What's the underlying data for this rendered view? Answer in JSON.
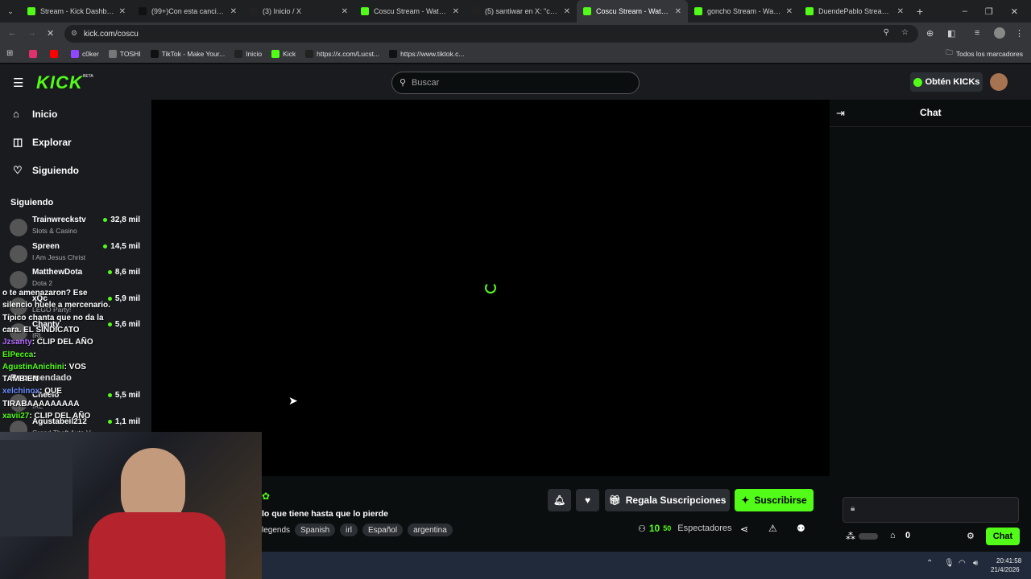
{
  "browser": {
    "tabs": [
      {
        "title": "Stream - Kick Dashboard",
        "icon": "kick-icon",
        "active": false
      },
      {
        "title": "(99+)Con esta canción m",
        "icon": "tiktok-icon",
        "active": false
      },
      {
        "title": "(3) Inicio / X",
        "icon": "x-icon",
        "active": false
      },
      {
        "title": "Coscu Stream - Watch Liv",
        "icon": "kick-icon",
        "active": false
      },
      {
        "title": "(5) santiwar en X: \"coscu c",
        "icon": "x-icon",
        "active": false
      },
      {
        "title": "Coscu Stream - Watch Liv",
        "icon": "kick-icon",
        "active": true
      },
      {
        "title": "goncho Stream - Watch L",
        "icon": "kick-icon",
        "active": false
      },
      {
        "title": "DuendePablo Stream - W",
        "icon": "kick-icon",
        "active": false
      }
    ],
    "url": "kick.com/coscu",
    "bookmarks": [
      {
        "label": "",
        "icon": "instagram-icon"
      },
      {
        "label": "",
        "icon": "youtube-icon"
      },
      {
        "label": "c0ker",
        "icon": "twitch-icon"
      },
      {
        "label": "TOSHI",
        "icon": "bookmark-icon"
      },
      {
        "label": "TikTok - Make Your...",
        "icon": "tiktok-icon"
      },
      {
        "label": "Inicio",
        "icon": "x-icon"
      },
      {
        "label": "Kick",
        "icon": "kick-icon"
      },
      {
        "label": "https://x.com/Lucst...",
        "icon": "x-icon"
      },
      {
        "label": "https://www.tiktok.c...",
        "icon": "tiktok-icon"
      }
    ],
    "all_bookmarks": "Todos los marcadores"
  },
  "header": {
    "logo": "KICK",
    "beta": "BETA",
    "search_placeholder": "Buscar",
    "kicks_button": "Obtén KICKs"
  },
  "sidebar": {
    "nav": [
      {
        "label": "Inicio",
        "icon": "home-icon"
      },
      {
        "label": "Explorar",
        "icon": "compass-icon"
      },
      {
        "label": "Siguiendo",
        "icon": "heart-icon"
      }
    ],
    "following_title": "Siguiendo",
    "following": [
      {
        "name": "Trainwreckstv",
        "category": "Slots & Casino",
        "viewers": "32,8 mil"
      },
      {
        "name": "Spreen",
        "category": "I Am Jesus Christ",
        "viewers": "14,5 mil"
      },
      {
        "name": "MatthewDota",
        "category": "Dota 2",
        "viewers": "8,6 mil"
      },
      {
        "name": "xQc",
        "category": "LEGO Party!",
        "viewers": "5,9 mil"
      },
      {
        "name": "Chanty",
        "category": "IRL",
        "viewers": "5,6 mil"
      }
    ],
    "recommended_title": "Recomendado",
    "recommended": [
      {
        "name": "Cheelo",
        "category": "IRL",
        "viewers": "5,5 mil"
      },
      {
        "name": "Agustabell212",
        "category": "Grand Theft Auto V",
        "viewers": "1,1 mil"
      }
    ]
  },
  "chat_overlay": [
    {
      "user": "",
      "text": "o te amenazaron? Ese"
    },
    {
      "user": "",
      "text": "silencio huele a mercenario."
    },
    {
      "user": "",
      "text": "Típico chanta que no da la"
    },
    {
      "user": "",
      "text": "cara. EL SINDICATO"
    },
    {
      "user": "Jzsanty",
      "text": ": CLIP DEL AÑO",
      "color": "#b36bff"
    },
    {
      "user": "ElPecca",
      "text": ":",
      "color": "#53fc18"
    },
    {
      "user": "AgustinAnichini",
      "text": ": VOS",
      "color": "#53fc18"
    },
    {
      "user": "",
      "text": "TAMBIEN"
    },
    {
      "user": "xelchinox",
      "text": ": QUE",
      "color": "#6b8cff"
    },
    {
      "user": "",
      "text": "TIRABAAAAAAAAA"
    },
    {
      "user": "xavii27",
      "text": ": CLIP DEL AÑO",
      "color": "#53fc18"
    }
  ],
  "stream": {
    "title": "lo que tiene hasta que lo pierde",
    "tags": [
      "legends",
      "Spanish",
      "irl",
      "Español",
      "argentina"
    ],
    "gift_button": "Regala Suscripciones",
    "subscribe_button": "Suscribirse",
    "viewers_value": "10",
    "viewers_sup": "50",
    "viewers_label": "Espectadores"
  },
  "chat": {
    "title": "Chat",
    "send_button": "Chat",
    "kicks_count": "0"
  },
  "taskbar": {
    "time": "20:41:58",
    "date": "21/4/2026"
  },
  "colors": {
    "brand": "#53fc18",
    "bg": "#0b0e0f",
    "panel": "#191b1f"
  }
}
